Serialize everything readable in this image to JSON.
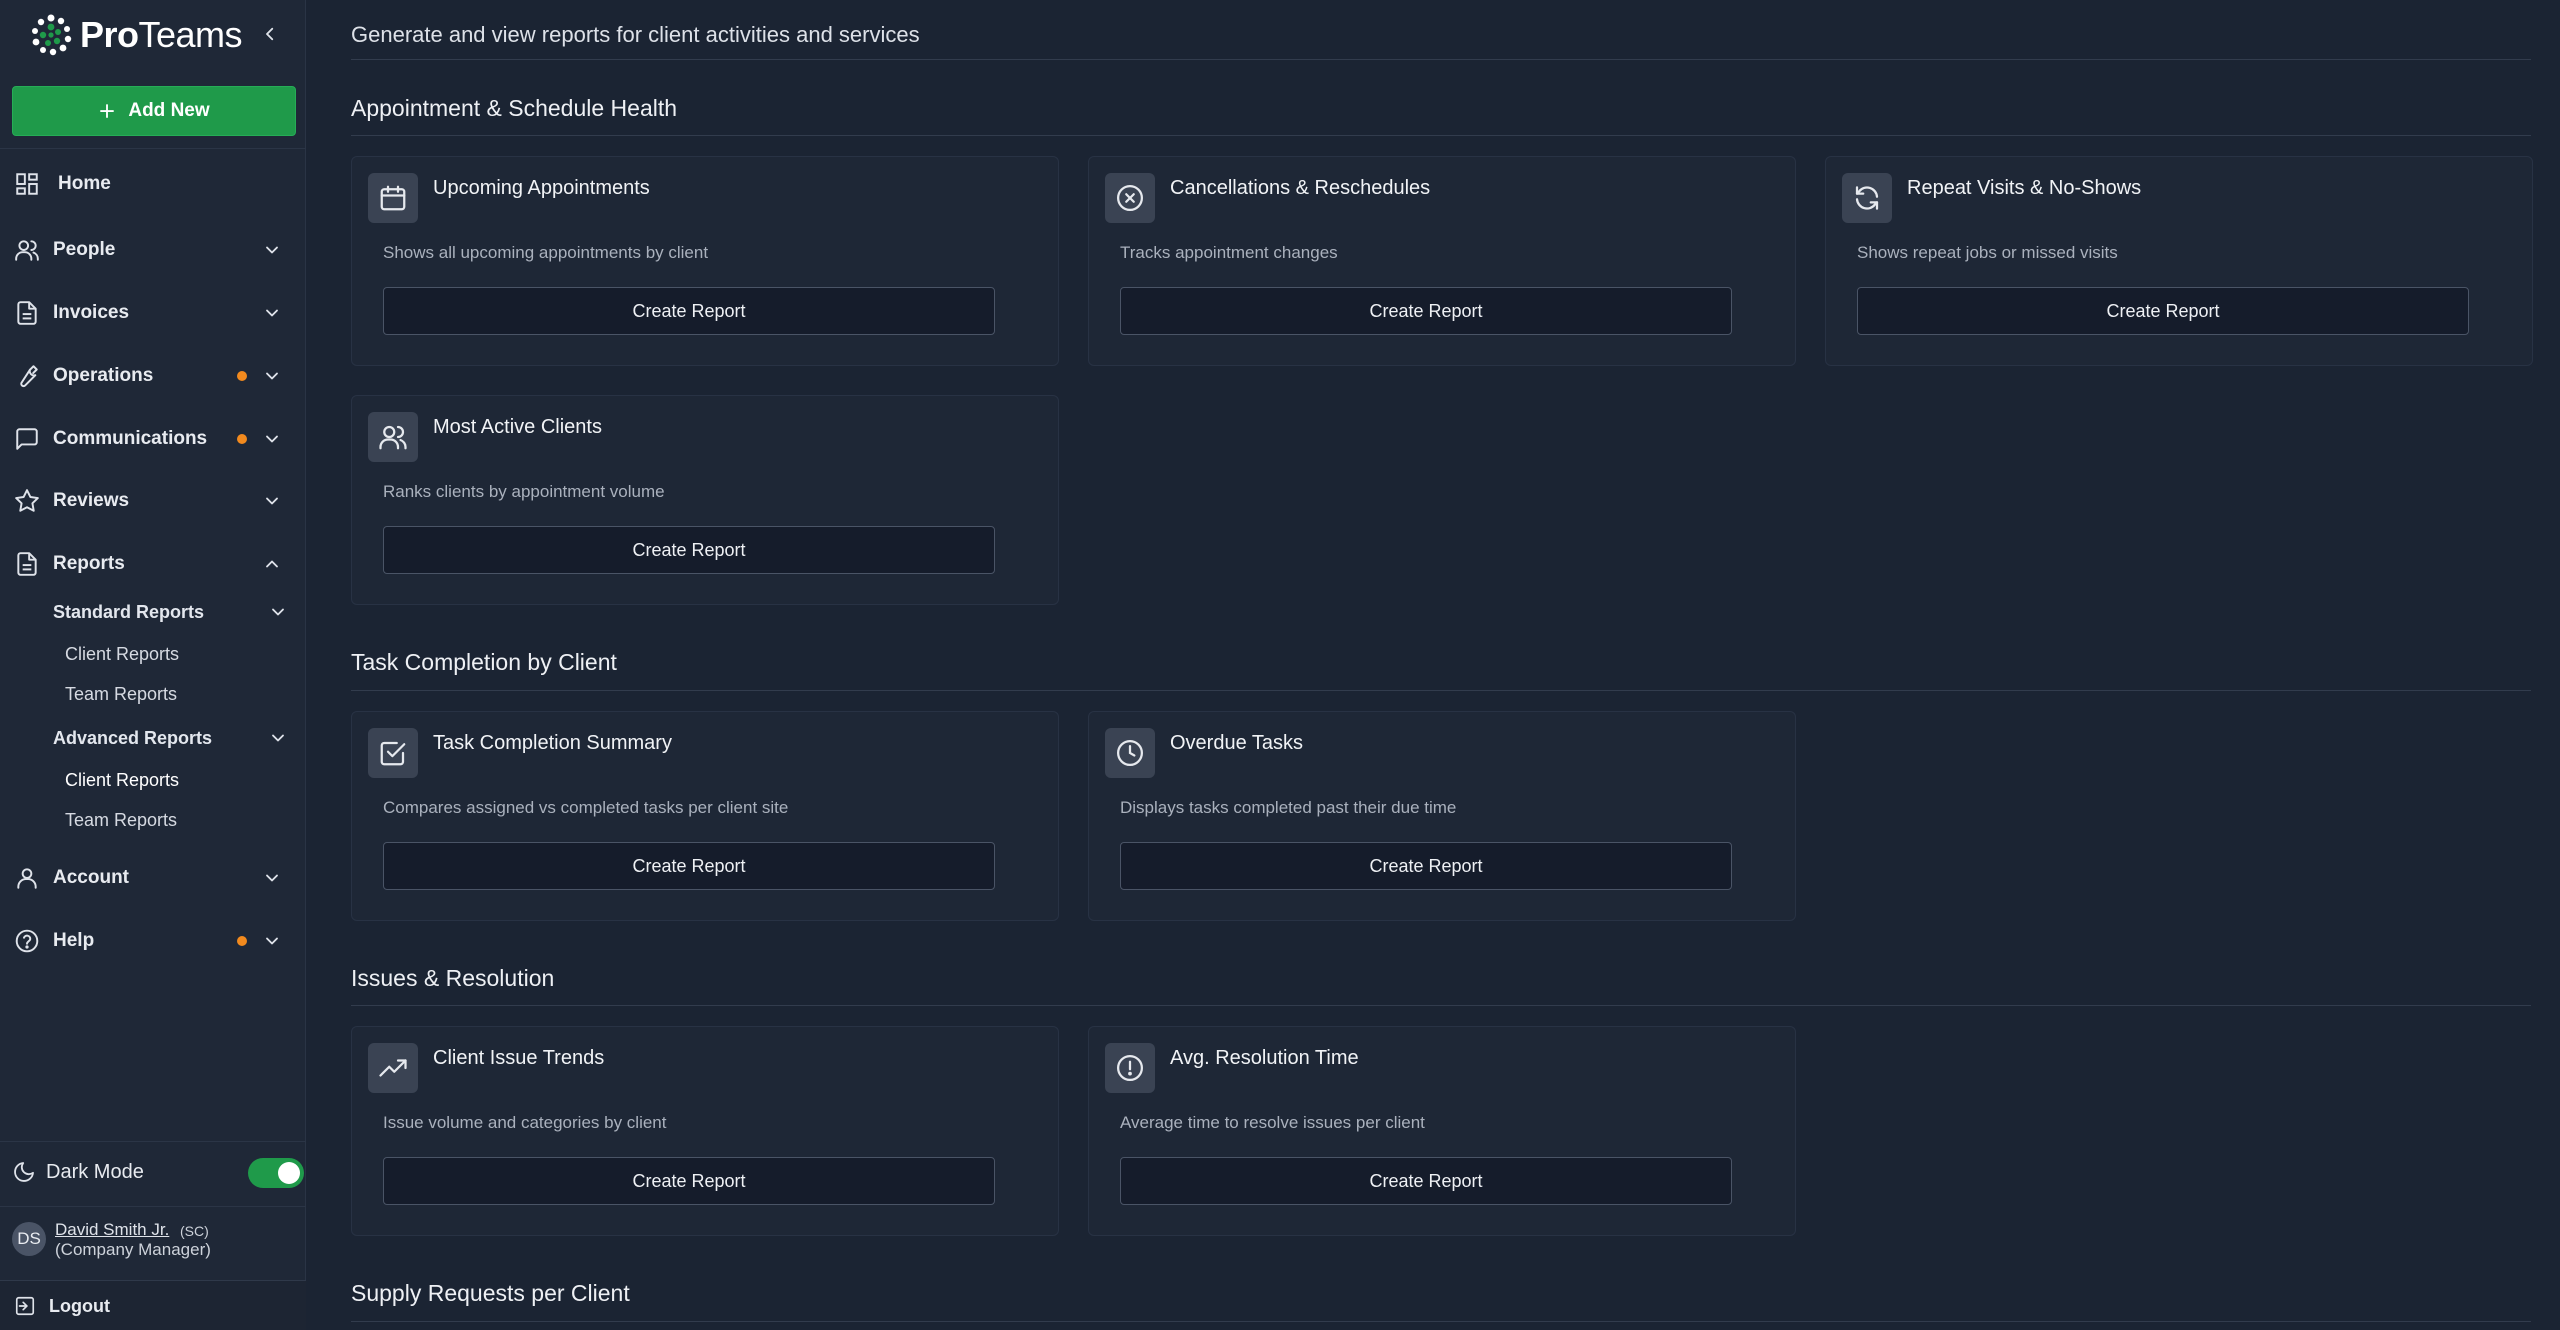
{
  "sidebar": {
    "logo": {
      "text_bold": "Pro",
      "text_rest": "Teams"
    },
    "add_new_label": "Add New",
    "nav": {
      "home": "Home",
      "people": "People",
      "invoices": "Invoices",
      "operations": "Operations",
      "communications": "Communications",
      "reviews": "Reviews",
      "reports": "Reports",
      "account": "Account",
      "help": "Help"
    },
    "reports_sub": {
      "standard": {
        "label": "Standard Reports",
        "client": "Client Reports",
        "team": "Team Reports"
      },
      "advanced": {
        "label": "Advanced Reports",
        "client": "Client Reports",
        "team": "Team Reports"
      }
    },
    "dark_mode_label": "Dark Mode",
    "user": {
      "initials": "DS",
      "name": "David Smith Jr.",
      "tag": "(SC)",
      "role": "(Company Manager)"
    },
    "logout_label": "Logout",
    "accent_color": "#1f9a4a",
    "notification_color": "#f28a1e"
  },
  "main": {
    "subtitle": "Generate and view reports for client activities and services",
    "create_report_label": "Create Report",
    "sections": {
      "appointments": {
        "title": "Appointment & Schedule Health",
        "cards": [
          {
            "icon": "calendar-icon",
            "title": "Upcoming Appointments",
            "desc": "Shows all upcoming appointments by client"
          },
          {
            "icon": "x-circle-icon",
            "title": "Cancellations & Reschedules",
            "desc": "Tracks appointment changes"
          },
          {
            "icon": "refresh-icon",
            "title": "Repeat Visits & No-Shows",
            "desc": "Shows repeat jobs or missed visits"
          },
          {
            "icon": "users-icon",
            "title": "Most Active Clients",
            "desc": "Ranks clients by appointment volume"
          }
        ]
      },
      "tasks": {
        "title": "Task Completion by Client",
        "cards": [
          {
            "icon": "check-square-icon",
            "title": "Task Completion Summary",
            "desc": "Compares assigned vs completed tasks per client site"
          },
          {
            "icon": "clock-icon",
            "title": "Overdue Tasks",
            "desc": "Displays tasks completed past their due time"
          }
        ]
      },
      "issues": {
        "title": "Issues & Resolution",
        "cards": [
          {
            "icon": "trending-up-icon",
            "title": "Client Issue Trends",
            "desc": "Issue volume and categories by client"
          },
          {
            "icon": "alert-circle-icon",
            "title": "Avg. Resolution Time",
            "desc": "Average time to resolve issues per client"
          }
        ]
      },
      "supply": {
        "title": "Supply Requests per Client"
      }
    }
  }
}
